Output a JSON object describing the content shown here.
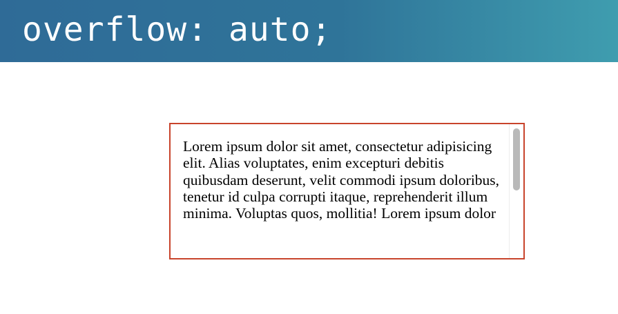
{
  "header": {
    "title": "overflow: auto;"
  },
  "demo": {
    "text": "Lorem ipsum dolor sit amet, consectetur adipisicing elit. Alias voluptates, enim excepturi debitis quibusdam deserunt, velit commodi ipsum doloribus, tenetur id culpa corrupti itaque, reprehenderit illum minima. Voluptas quos, mollitia! Lorem ipsum dolor",
    "scroll_position_fraction": 0.0
  },
  "colors": {
    "banner_gradient_start": "#2f6b97",
    "banner_gradient_end": "#3f9daf",
    "box_border": "#c8432b",
    "scrollbar_thumb": "#b9b9b9"
  }
}
